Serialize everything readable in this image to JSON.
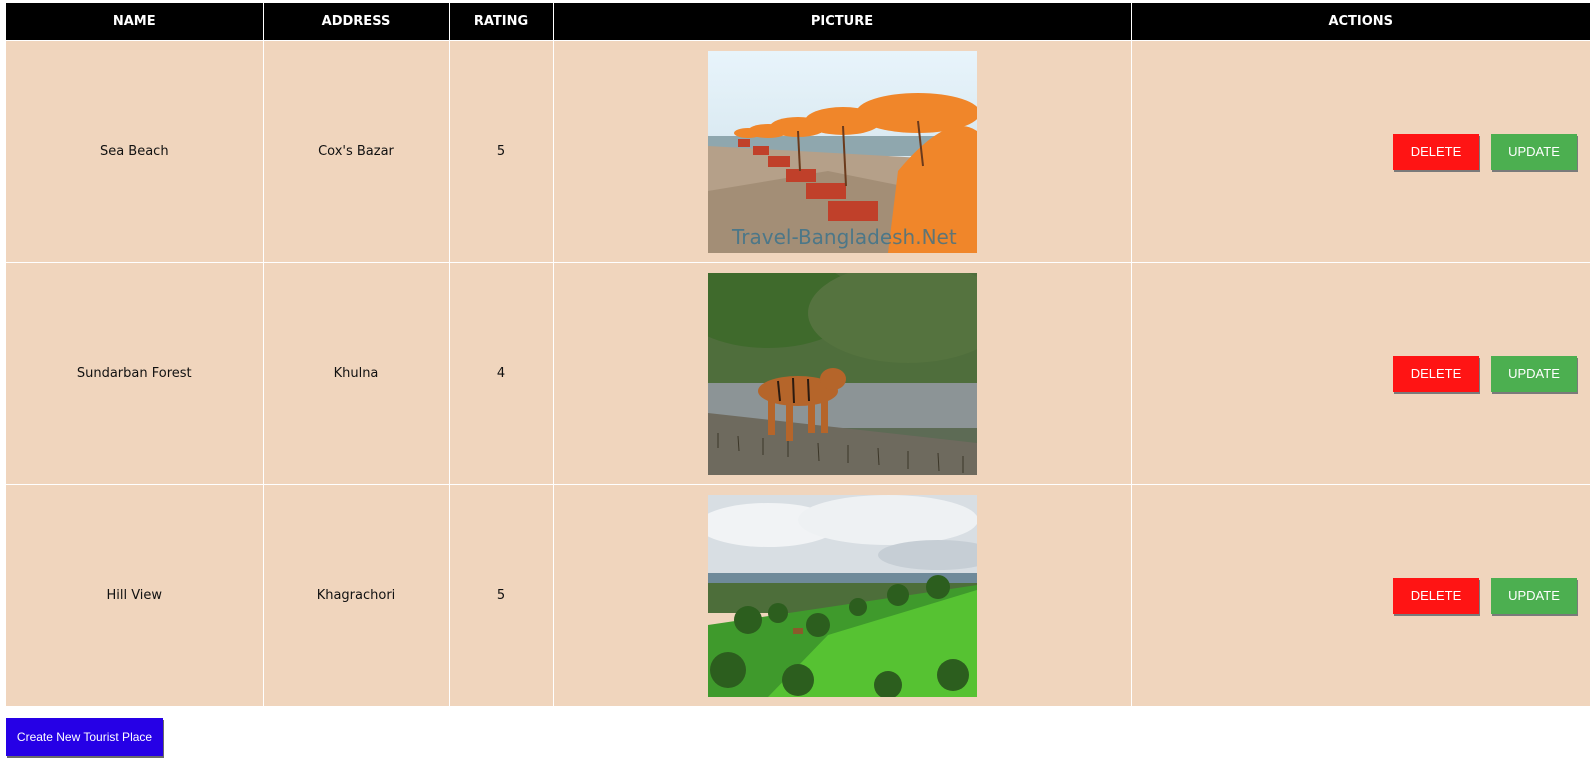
{
  "table": {
    "headers": {
      "name": "NAME",
      "address": "ADDRESS",
      "rating": "RATING",
      "picture": "PICTURE",
      "actions": "ACTIONS"
    },
    "rows": [
      {
        "name": "Sea Beach",
        "address": "Cox's Bazar",
        "rating": "5",
        "picture_subject": "beach-umbrellas",
        "watermark": "Travel-Bangladesh.Net"
      },
      {
        "name": "Sundarban Forest",
        "address": "Khulna",
        "rating": "4",
        "picture_subject": "tiger-mangrove"
      },
      {
        "name": "Hill View",
        "address": "Khagrachori",
        "rating": "5",
        "picture_subject": "green-hills"
      }
    ],
    "delete_label": "DELETE",
    "update_label": "UPDATE"
  },
  "create_button_label": "Create New Tourist Place",
  "colors": {
    "header_bg": "#000000",
    "row_bg": "#f0d5bd",
    "delete": "#ff1414",
    "update": "#4caf50",
    "create": "#2600e6"
  }
}
